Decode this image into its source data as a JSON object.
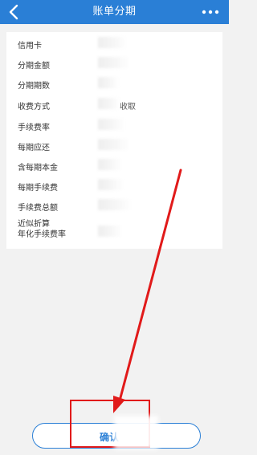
{
  "header": {
    "title": "账单分期",
    "back_icon": "chevron-left-icon",
    "more_icon": "more-dots-icon",
    "background": "#2a7fd6"
  },
  "details": {
    "rows": [
      {
        "label": "信用卡"
      },
      {
        "label": "分期金额"
      },
      {
        "label": "分期期数"
      },
      {
        "label": "收费方式",
        "visible_fragment": "收取"
      },
      {
        "label": "手续费率"
      },
      {
        "label": "每期应还"
      },
      {
        "label": "含每期本金"
      },
      {
        "label": "每期手续费"
      },
      {
        "label": "手续费总额"
      },
      {
        "label_line1": "近似折算",
        "label_line2": "年化手续费率"
      }
    ]
  },
  "footer": {
    "confirm_label": "确认",
    "accent": "#2a7fd6"
  },
  "annotation": {
    "highlight_color": "#e11a1a"
  }
}
